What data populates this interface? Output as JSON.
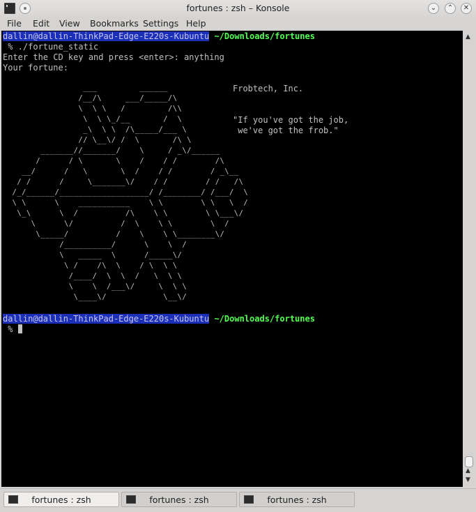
{
  "window": {
    "title": "fortunes : zsh – Konsole"
  },
  "menu": [
    "File",
    "Edit",
    "View",
    "Bookmarks",
    "Settings",
    "Help"
  ],
  "terminal": {
    "user_host": "dallin@dallin-ThinkPad-Edge-E220s-Kubuntu",
    "cwd": " ~/Downloads/fortunes",
    "command_line": " % ./fortune_static",
    "line_cdkey": "Enter the CD key and press <enter>: anything",
    "line_fortune": "Your fortune:",
    "company": "Frobtech, Inc.",
    "quote_line1": "\"If you've got the job,",
    "quote_line2": " we've got the frob.\"",
    "prompt_symbol": " % ",
    "ascii_art": "                 ___         ______\n                /__/\\     ___/_____/\\\n                \\  \\ \\   /         /\\\\\n                 \\  \\ \\_/__       /  \\\n                 _\\  \\ \\  /\\_____/___ \\\n                // \\__\\/ /  \\       /\\ \\\n        _______//_______/    \\     / _\\/______\n       /      / \\       \\    /    / /        /\\\n    __/      /   \\       \\  /    / /        / _\\__\n   / /      /     \\_______\\/    / /        / /   /\\\n  /_/______/___________________/ /________/ /___/  \\\n  \\ \\      \\    ___________    \\ \\        \\ \\   \\  /\n   \\_\\      \\  /          /\\    \\ \\        \\ \\___\\/\n      \\      \\/          /  \\    \\ \\        \\  /\n       \\_____/          /    \\    \\ \\________\\/\n            /__________/      \\    \\  /\n            \\   _____  \\      /_____\\/\n             \\ /    /\\  \\    / \\  \\ \\\n              /____/  \\  \\  /   \\  \\ \\\n              \\    \\  /___\\/     \\  \\ \\\n               \\____\\/            \\__\\/"
  },
  "tabs": [
    "fortunes : zsh",
    "fortunes : zsh",
    "fortunes : zsh"
  ],
  "colors": {
    "terminal_bg": "#000000",
    "terminal_fg": "#c0c0c0",
    "prompt_highlight": "#1c2fb8",
    "path_green": "#54ff54"
  },
  "icons": {
    "app": "terminal-icon",
    "pin": "pin-icon",
    "minimize": "chevron-down-icon",
    "maximize": "chevron-up-icon",
    "close": "close-icon",
    "tab": "terminal-icon"
  }
}
